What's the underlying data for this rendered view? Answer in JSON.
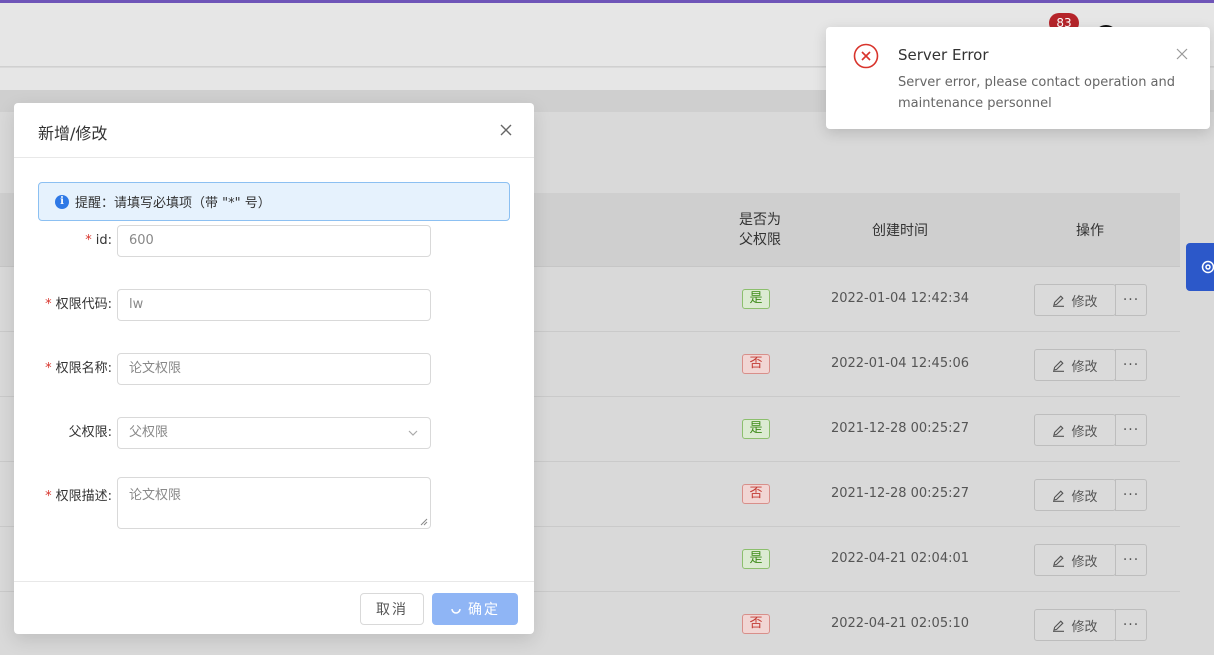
{
  "header": {
    "notification_count": "83"
  },
  "table": {
    "headers": {
      "is_parent": "是否为父权限",
      "created_at": "创建时间",
      "operations": "操作"
    },
    "rows": [
      {
        "is_parent": "是",
        "is_parent_flag": true,
        "created_at": "2022-01-04 12:42:34"
      },
      {
        "is_parent": "否",
        "is_parent_flag": false,
        "created_at": "2022-01-04 12:45:06"
      },
      {
        "is_parent": "是",
        "is_parent_flag": true,
        "created_at": "2021-12-28 00:25:27"
      },
      {
        "is_parent": "否",
        "is_parent_flag": false,
        "created_at": "2021-12-28 00:25:27"
      },
      {
        "is_parent": "是",
        "is_parent_flag": true,
        "created_at": "2022-04-21 02:04:01"
      },
      {
        "is_parent": "否",
        "is_parent_flag": false,
        "created_at": "2022-04-21 02:05:10"
      }
    ],
    "edit_label": "修改",
    "more_label": "···"
  },
  "modal": {
    "title": "新增/修改",
    "alert": "提醒：请填写必填项（带 \"*\" 号）",
    "fields": {
      "id": {
        "label": "id:",
        "value": "600",
        "required": true
      },
      "code": {
        "label": "权限代码:",
        "value": "lw",
        "required": true
      },
      "name": {
        "label": "权限名称:",
        "value": "论文权限",
        "required": true
      },
      "parent": {
        "label": "父权限:",
        "value": "父权限",
        "required": false
      },
      "desc": {
        "label": "权限描述:",
        "value": "论文权限",
        "required": true
      }
    },
    "required_mark": "*",
    "cancel_label": "取消",
    "ok_label": "确定"
  },
  "notification": {
    "title": "Server Error",
    "description": "Server error, please contact operation and maintenance personnel"
  },
  "colors": {
    "accent": "#2f79e6",
    "error": "#d8342c",
    "top_bar": "#6f55b8"
  }
}
